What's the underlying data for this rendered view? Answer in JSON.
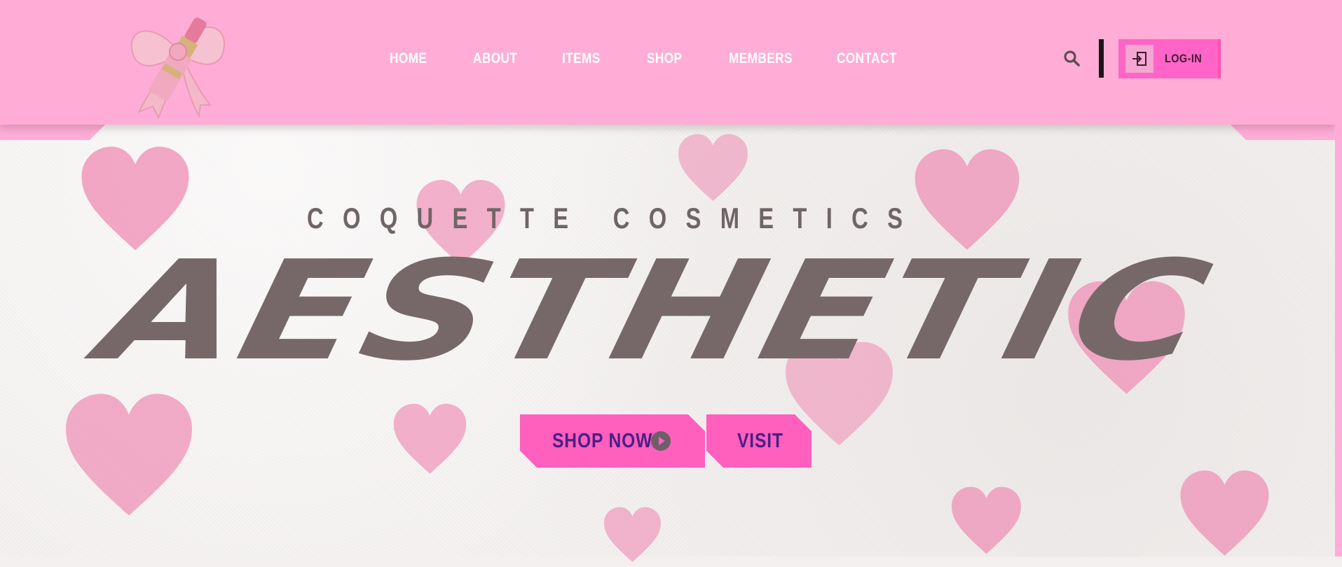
{
  "colors": {
    "header_bg": "#ffadd6",
    "accent_pink": "#ff5fbd",
    "title_gray": "#766869",
    "button_text": "#4a1f86"
  },
  "header": {
    "logo_icon": "bow-lipstick-logo",
    "nav": [
      {
        "label": "HOME"
      },
      {
        "label": "ABOUT"
      },
      {
        "label": "ITEMS"
      },
      {
        "label": "SHOP"
      },
      {
        "label": "MEMBERS"
      },
      {
        "label": "CONTACT"
      }
    ],
    "search_icon": "search-icon",
    "login": {
      "label": "LOG-IN",
      "icon": "login-icon"
    }
  },
  "hero": {
    "tagline": "COQUETTE COSMETICS",
    "title": "AESTHETIC",
    "shop_button": "SHOP NOW",
    "visit_button": "VISIT"
  }
}
